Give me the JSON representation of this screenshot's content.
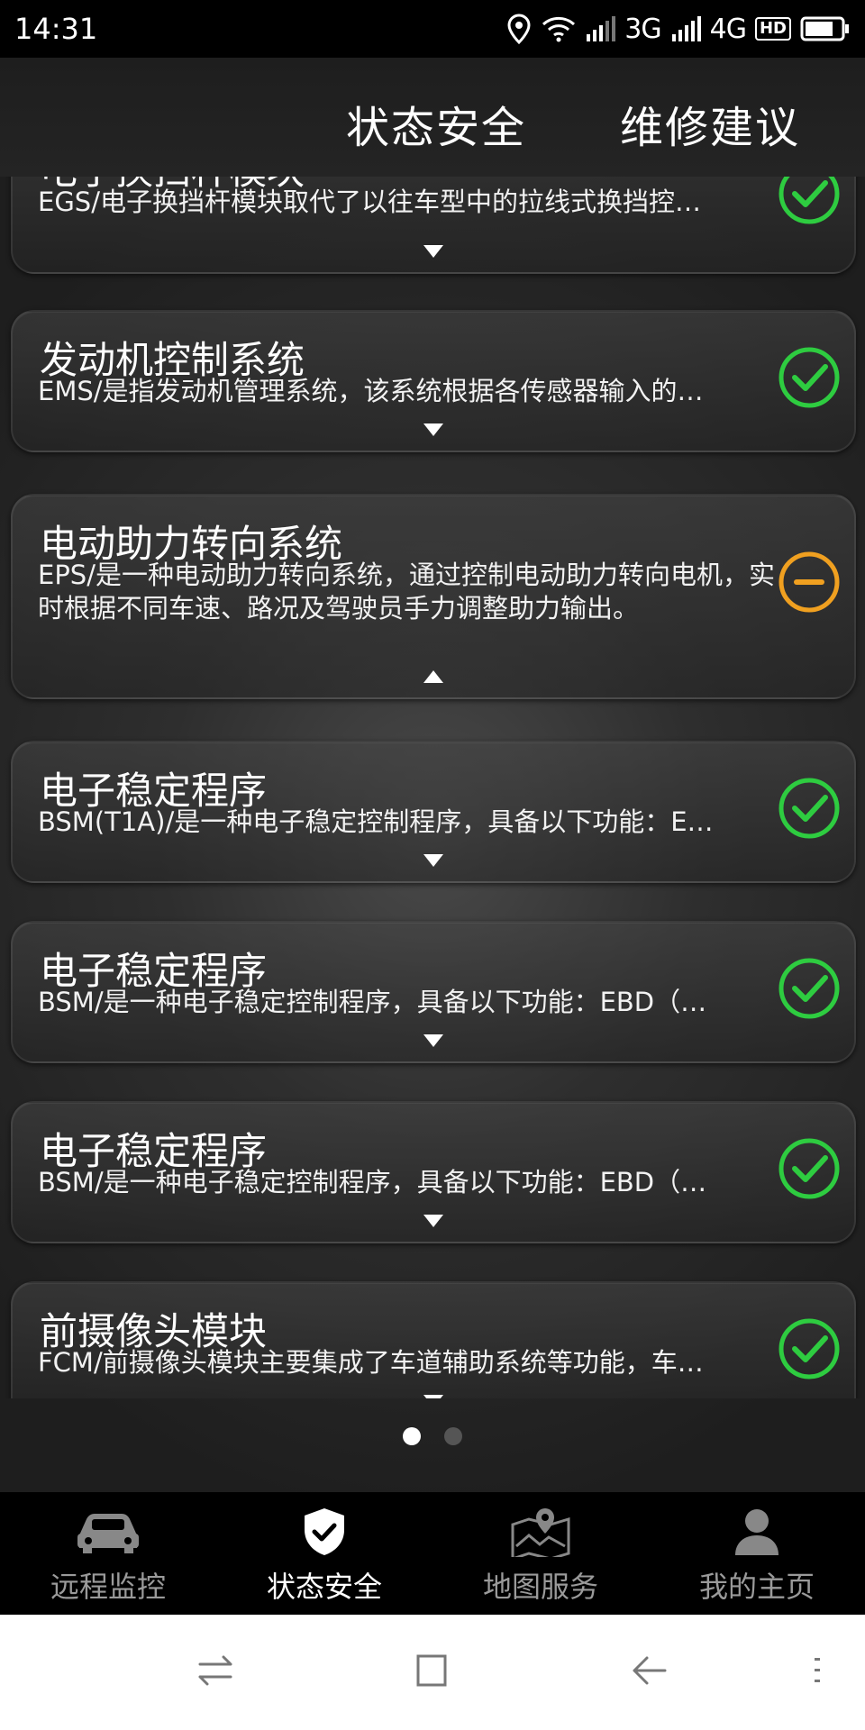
{
  "status_bar": {
    "time": "14:31",
    "network_3g": "3G",
    "network_4g": "4G",
    "hd_badge": "HD",
    "icons": [
      "location-icon",
      "wifi-icon",
      "signal-icon",
      "signal-icon",
      "battery-icon"
    ]
  },
  "top_tabs": [
    {
      "label": "状态安全"
    },
    {
      "label": "维修建议"
    }
  ],
  "cards": [
    {
      "title": "电子换挡杆模块",
      "desc": "EGS/电子换挡杆模块取代了以往车型中的拉线式换挡控…",
      "status": "ok",
      "expanded": false
    },
    {
      "title": "发动机控制系统",
      "desc": "EMS/是指发动机管理系统，该系统根据各传感器输入的…",
      "status": "ok",
      "expanded": false
    },
    {
      "title": "电动助力转向系统",
      "desc": "EPS/是一种电动助力转向系统，通过控制电动助力转向电机，实时根据不同车速、路况及驾驶员手力调整助力输出。",
      "status": "warning",
      "expanded": true
    },
    {
      "title": "电子稳定程序",
      "desc": "BSM(T1A)/是一种电子稳定控制程序，具备以下功能：E…",
      "status": "ok",
      "expanded": false
    },
    {
      "title": "电子稳定程序",
      "desc": "BSM/是一种电子稳定控制程序，具备以下功能：EBD（…",
      "status": "ok",
      "expanded": false
    },
    {
      "title": "电子稳定程序",
      "desc": "BSM/是一种电子稳定控制程序，具备以下功能：EBD（…",
      "status": "ok",
      "expanded": false
    },
    {
      "title": "前摄像头模块",
      "desc": "FCM/前摄像头模块主要集成了车道辅助系统等功能，车…",
      "status": "ok",
      "expanded": false
    }
  ],
  "colors": {
    "ok": "#2ecc40",
    "warning": "#f0a020"
  },
  "pager": {
    "page": 1,
    "total": 2
  },
  "bottom_nav": [
    {
      "label": "远程监控",
      "icon": "car-icon",
      "active": false
    },
    {
      "label": "状态安全",
      "icon": "shield-check-icon",
      "active": true
    },
    {
      "label": "地图服务",
      "icon": "map-pin-icon",
      "active": false
    },
    {
      "label": "我的主页",
      "icon": "user-icon",
      "active": false
    }
  ],
  "system_nav": [
    "switch-icon",
    "square-icon",
    "back-icon",
    "menu-icon"
  ]
}
